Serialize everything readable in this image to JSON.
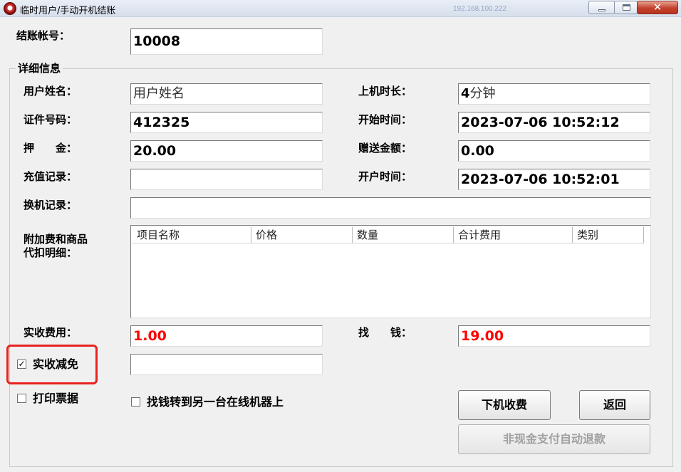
{
  "window": {
    "title": "临时用户/手动开机结账",
    "title_ip": "192.168.100.222",
    "close_symbol": "✕"
  },
  "checkout_account": {
    "label": "结账帐号：",
    "value": "10008"
  },
  "details": {
    "group_title": "详细信息",
    "user_name": {
      "label": "用户姓名：",
      "value": "用户姓名"
    },
    "online_duration": {
      "label": "上机时长：",
      "value_number": "4",
      "value_unit": "分钟"
    },
    "id_number": {
      "label": "证件号码：",
      "value": "412325"
    },
    "start_time": {
      "label": "开始时间：",
      "value": "2023-07-06 10:52:12"
    },
    "deposit": {
      "label": "押　　金：",
      "value": "20.00"
    },
    "bonus_amount": {
      "label": "赠送金额：",
      "value": "0.00"
    },
    "recharge_record": {
      "label": "充值记录：",
      "value": ""
    },
    "account_open_time": {
      "label": "开户时间：",
      "value": "2023-07-06 10:52:01"
    },
    "machine_change_record": {
      "label": "换机记录：",
      "value": ""
    },
    "extra_fees": {
      "label_line1": "附加费和商品",
      "label_line2": "代扣明细：",
      "columns": [
        "项目名称",
        "价格",
        "数量",
        "合计费用",
        "类别"
      ],
      "rows": []
    },
    "actual_fee": {
      "label": "实收费用：",
      "value": "1.00"
    },
    "change": {
      "label": "找　　钱：",
      "value": "19.00"
    },
    "actual_reduction": {
      "label": "实收减免",
      "checked": true,
      "check_mark": "✓",
      "value": ""
    },
    "print_receipt": {
      "label": "打印票据",
      "checked": false
    },
    "transfer_change": {
      "label": "找钱转到另一台在线机器上",
      "checked": false
    }
  },
  "buttons": {
    "logoff_charge": "下机收费",
    "back": "返回",
    "non_cash_refund": "非现金支付自动退款"
  },
  "colors": {
    "money_red": "#ff0000",
    "highlight_red": "#e8231f",
    "disabled_text": "#a0a0a0"
  }
}
